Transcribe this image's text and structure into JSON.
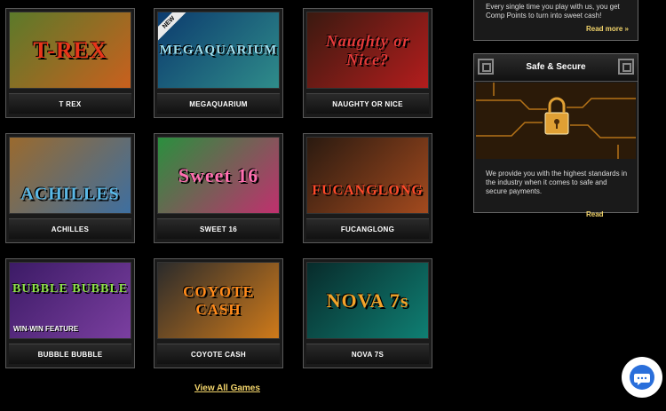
{
  "games": [
    {
      "caption": "T REX",
      "art_text": "T-REX",
      "colors": [
        "#5b7a2a",
        "#c9601e"
      ]
    },
    {
      "caption": "MEGAQUARIUM",
      "art_text": "MEGAQUARIUM",
      "badge": "NEW",
      "colors": [
        "#0c3b6e",
        "#2f8c8a"
      ]
    },
    {
      "caption": "NAUGHTY OR NICE",
      "art_text": "Naughty or Nice?",
      "colors": [
        "#3a1a10",
        "#b31d1d"
      ]
    },
    {
      "caption": "ACHILLES",
      "art_text": "ACHILLES",
      "colors": [
        "#9a6a2e",
        "#3e6fa0"
      ]
    },
    {
      "caption": "SWEET 16",
      "art_text": "Sweet 16",
      "colors": [
        "#2a8f3e",
        "#c0306e"
      ]
    },
    {
      "caption": "FUCANGLONG",
      "art_text": "FUCANGLONG",
      "colors": [
        "#2a1a10",
        "#a34a1e"
      ]
    },
    {
      "caption": "BUBBLE BUBBLE",
      "art_text": "BUBBLE BUBBLE",
      "art_sub": "WIN-WIN FEATURE",
      "colors": [
        "#3c1b66",
        "#7b3fa0"
      ]
    },
    {
      "caption": "COYOTE CASH",
      "art_text": "COYOTE CASH",
      "colors": [
        "#2b2b2b",
        "#cf7a1a"
      ]
    },
    {
      "caption": "NOVA 7S",
      "art_text": "NOVA 7s",
      "colors": [
        "#082b2b",
        "#0f7f73"
      ]
    }
  ],
  "view_all": "View All Games",
  "comp_panel": {
    "text": "Every single time you play with us, you get Comp Points to turn into sweet cash!",
    "read_more": "Read more »"
  },
  "safe_panel": {
    "title": "Safe & Secure",
    "text": "We provide you with the highest standards in the industry when it comes to safe and secure payments.",
    "read_more": "Read"
  },
  "accent_color": "#f2d46b",
  "chat_icon": "chat-bubble-icon"
}
